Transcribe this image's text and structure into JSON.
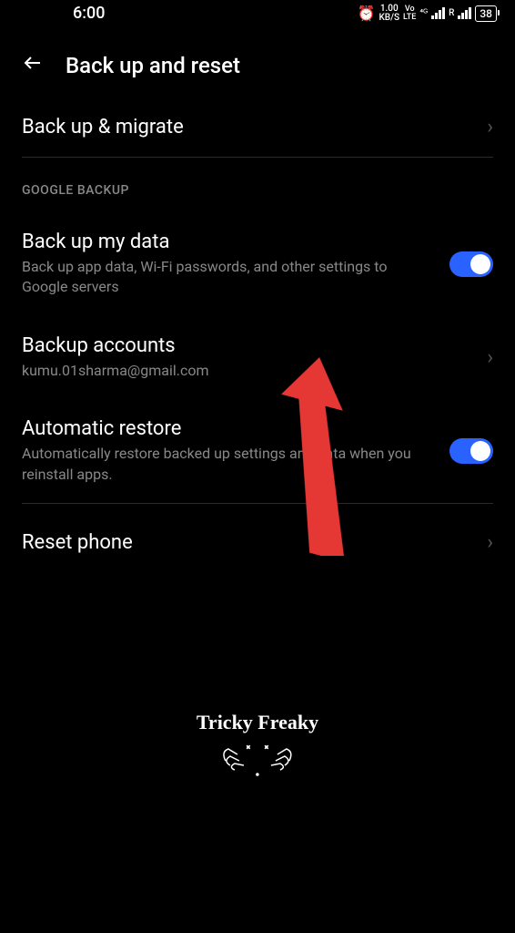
{
  "status_bar": {
    "time": "6:00",
    "kb_speed": "1.00",
    "kb_unit": "KB/S",
    "vo_lte": "Vo LTE",
    "network": "4G",
    "roaming": "R",
    "battery": "38"
  },
  "header": {
    "title": "Back up and reset"
  },
  "items": {
    "backup_migrate": {
      "title": "Back up & migrate"
    },
    "section_google": "GOOGLE BACKUP",
    "backup_data": {
      "title": "Back up my data",
      "subtitle": "Back up app data, Wi-Fi passwords, and other settings to Google servers",
      "toggle": true
    },
    "backup_accounts": {
      "title": "Backup accounts",
      "subtitle": "kumu.01sharma@gmail.com"
    },
    "auto_restore": {
      "title": "Automatic restore",
      "subtitle": "Automatically restore backed up settings and data when you reinstall apps.",
      "toggle": true
    },
    "reset_phone": {
      "title": "Reset phone"
    }
  },
  "watermark": "Tricky Freaky"
}
